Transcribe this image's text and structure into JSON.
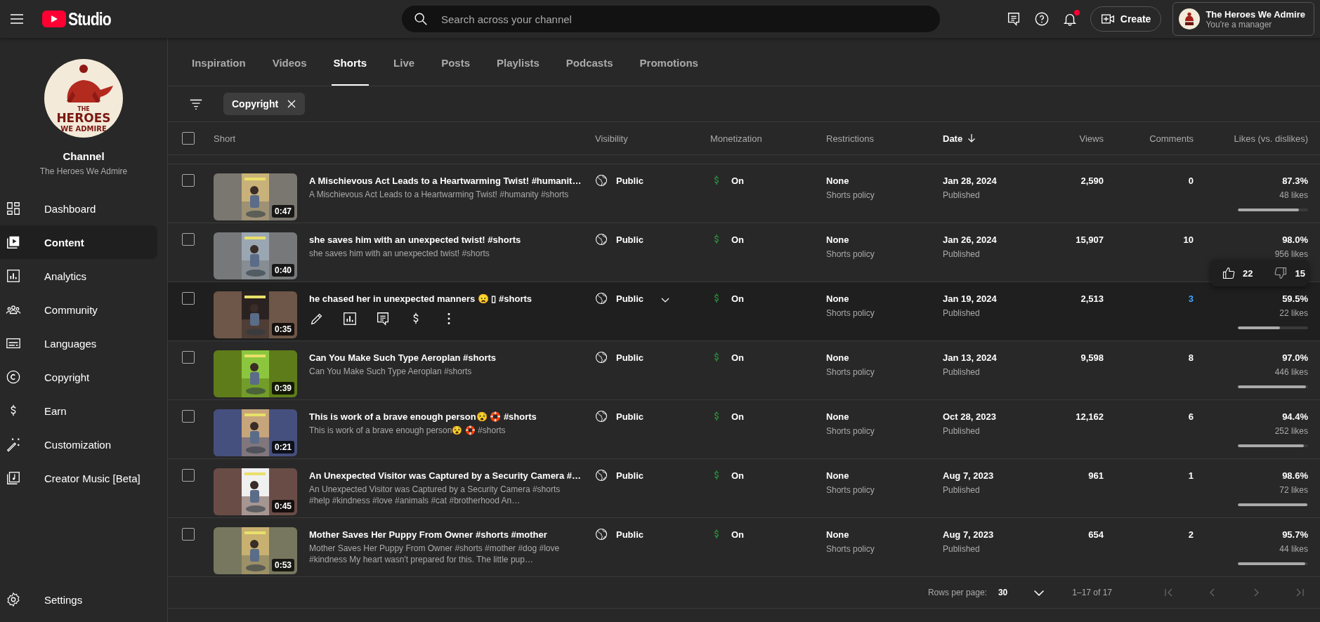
{
  "topbar": {
    "logo_text": "Studio",
    "search": {
      "placeholder": "Search across your channel"
    },
    "notifications_unread": true,
    "create_label": "Create",
    "account": {
      "name": "The Heroes We Admire",
      "role": "You're a manager"
    }
  },
  "sidebar": {
    "channel_logo_lines": [
      "THE",
      "HEROES",
      "WE ADMIRE"
    ],
    "channel_label": "Channel",
    "channel_name": "The Heroes We Admire",
    "items": [
      {
        "label": "Dashboard",
        "selected": false
      },
      {
        "label": "Content",
        "selected": true
      },
      {
        "label": "Analytics",
        "selected": false
      },
      {
        "label": "Community",
        "selected": false
      },
      {
        "label": "Languages",
        "selected": false
      },
      {
        "label": "Copyright",
        "selected": false
      },
      {
        "label": "Earn",
        "selected": false
      },
      {
        "label": "Customization",
        "selected": false
      },
      {
        "label": "Creator Music [Beta]",
        "selected": false
      }
    ],
    "settings_label": "Settings"
  },
  "tabs": [
    {
      "label": "Inspiration",
      "selected": false
    },
    {
      "label": "Videos",
      "selected": false
    },
    {
      "label": "Shorts",
      "selected": true
    },
    {
      "label": "Live",
      "selected": false
    },
    {
      "label": "Posts",
      "selected": false
    },
    {
      "label": "Playlists",
      "selected": false
    },
    {
      "label": "Podcasts",
      "selected": false
    },
    {
      "label": "Promotions",
      "selected": false
    }
  ],
  "filter_chip": "Copyright",
  "table": {
    "select_all_checked": false,
    "columns": [
      {
        "label": "Short",
        "sorted": false
      },
      {
        "label": "Visibility",
        "sorted": false
      },
      {
        "label": "Monetization",
        "sorted": false
      },
      {
        "label": "Restrictions",
        "sorted": false
      },
      {
        "label": "Date",
        "sorted": true
      },
      {
        "label": "Views",
        "sorted": false
      },
      {
        "label": "Comments",
        "sorted": false
      },
      {
        "label": "Likes (vs. dislikes)",
        "sorted": false
      }
    ],
    "rows": [
      {
        "checked": false,
        "hovered": false,
        "duration": "0:47",
        "title": "A Mischievous Act Leads to a Heartwarming Twist! #humanit…",
        "description": "A Mischievous Act Leads to a Heartwarming Twist! #humanity #shorts",
        "visibility": "Public",
        "monetization": "On",
        "restriction": "None",
        "restriction_note": "Shorts policy",
        "date": "Jan 28, 2024",
        "date_note": "Published",
        "views": "2,590",
        "comments": "0",
        "likes_pct": "87.3%",
        "likes": "48 likes",
        "level": 0.873
      },
      {
        "checked": false,
        "hovered": false,
        "duration": "0:40",
        "title": "she saves him with an unexpected twist! #shorts",
        "description": "she saves him with an unexpected twist! #shorts",
        "visibility": "Public",
        "monetization": "On",
        "restriction": "None",
        "restriction_note": "Shorts policy",
        "date": "Jan 26, 2024",
        "date_note": "Published",
        "views": "15,907",
        "comments": "10",
        "likes_pct": "98.0%",
        "likes": "956 likes"
      },
      {
        "checked": false,
        "hovered": true,
        "duration": "0:35",
        "title": "he chased her in unexpected manners 😦 ▯ #shorts",
        "visibility": "Public",
        "monetization": "On",
        "restriction": "None",
        "restriction_note": "Shorts policy",
        "date": "Jan 19, 2024",
        "date_note": "Published",
        "views": "2,513",
        "comments": "3",
        "likes_pct": "59.5%",
        "likes": "22 likes",
        "level": 0.595
      },
      {
        "checked": false,
        "hovered": false,
        "duration": "0:39",
        "title": "Can You Make Such Type Aeroplan #shorts",
        "description": "Can You Make Such Type Aeroplan #shorts",
        "visibility": "Public",
        "monetization": "On",
        "restriction": "None",
        "restriction_note": "Shorts policy",
        "date": "Jan 13, 2024",
        "date_note": "Published",
        "views": "9,598",
        "comments": "8",
        "likes_pct": "97.0%",
        "likes": "446 likes",
        "level": 0.97
      },
      {
        "checked": false,
        "hovered": false,
        "duration": "0:21",
        "title": "This is work of a brave enough person😵 🛟 #shorts",
        "description": "This is work of a brave enough person😵 🛟 #shorts",
        "visibility": "Public",
        "monetization": "On",
        "restriction": "None",
        "restriction_note": "Shorts policy",
        "date": "Oct 28, 2023",
        "date_note": "Published",
        "views": "12,162",
        "comments": "6",
        "likes_pct": "94.4%",
        "likes": "252 likes",
        "level": 0.944
      },
      {
        "checked": false,
        "hovered": false,
        "duration": "0:45",
        "title": "An Unexpected Visitor was Captured by a Security Camera #…",
        "description": "An Unexpected Visitor was Captured by a Security Camera #shorts #help #kindness #love #animals #cat #brotherhood An…",
        "visibility": "Public",
        "monetization": "On",
        "restriction": "None",
        "restriction_note": "Shorts policy",
        "date": "Aug 7, 2023",
        "date_note": "Published",
        "views": "961",
        "comments": "1",
        "likes_pct": "98.6%",
        "likes": "72 likes",
        "level": 0.986
      },
      {
        "checked": false,
        "hovered": false,
        "duration": "0:53",
        "title": "Mother Saves Her Puppy From Owner #shorts #mother",
        "description": "Mother Saves Her Puppy From Owner #shorts #mother #dog #love #kindness My heart wasn't prepared for this. The little pup…",
        "visibility": "Public",
        "monetization": "On",
        "restriction": "None",
        "restriction_note": "Shorts policy",
        "date": "Aug 7, 2023",
        "date_note": "Published",
        "views": "654",
        "comments": "2",
        "likes_pct": "95.7%",
        "likes": "44 likes",
        "level": 0.957
      }
    ]
  },
  "likes_tooltip": {
    "likes": "22",
    "dislikes": "15"
  },
  "pagination": {
    "rows_per_page_label": "Rows per page:",
    "rows_per_page": "30",
    "range": "1–17 of 17",
    "buttons": [
      {
        "disabled": true
      },
      {
        "disabled": true
      },
      {
        "disabled": true
      },
      {
        "disabled": true
      }
    ]
  }
}
